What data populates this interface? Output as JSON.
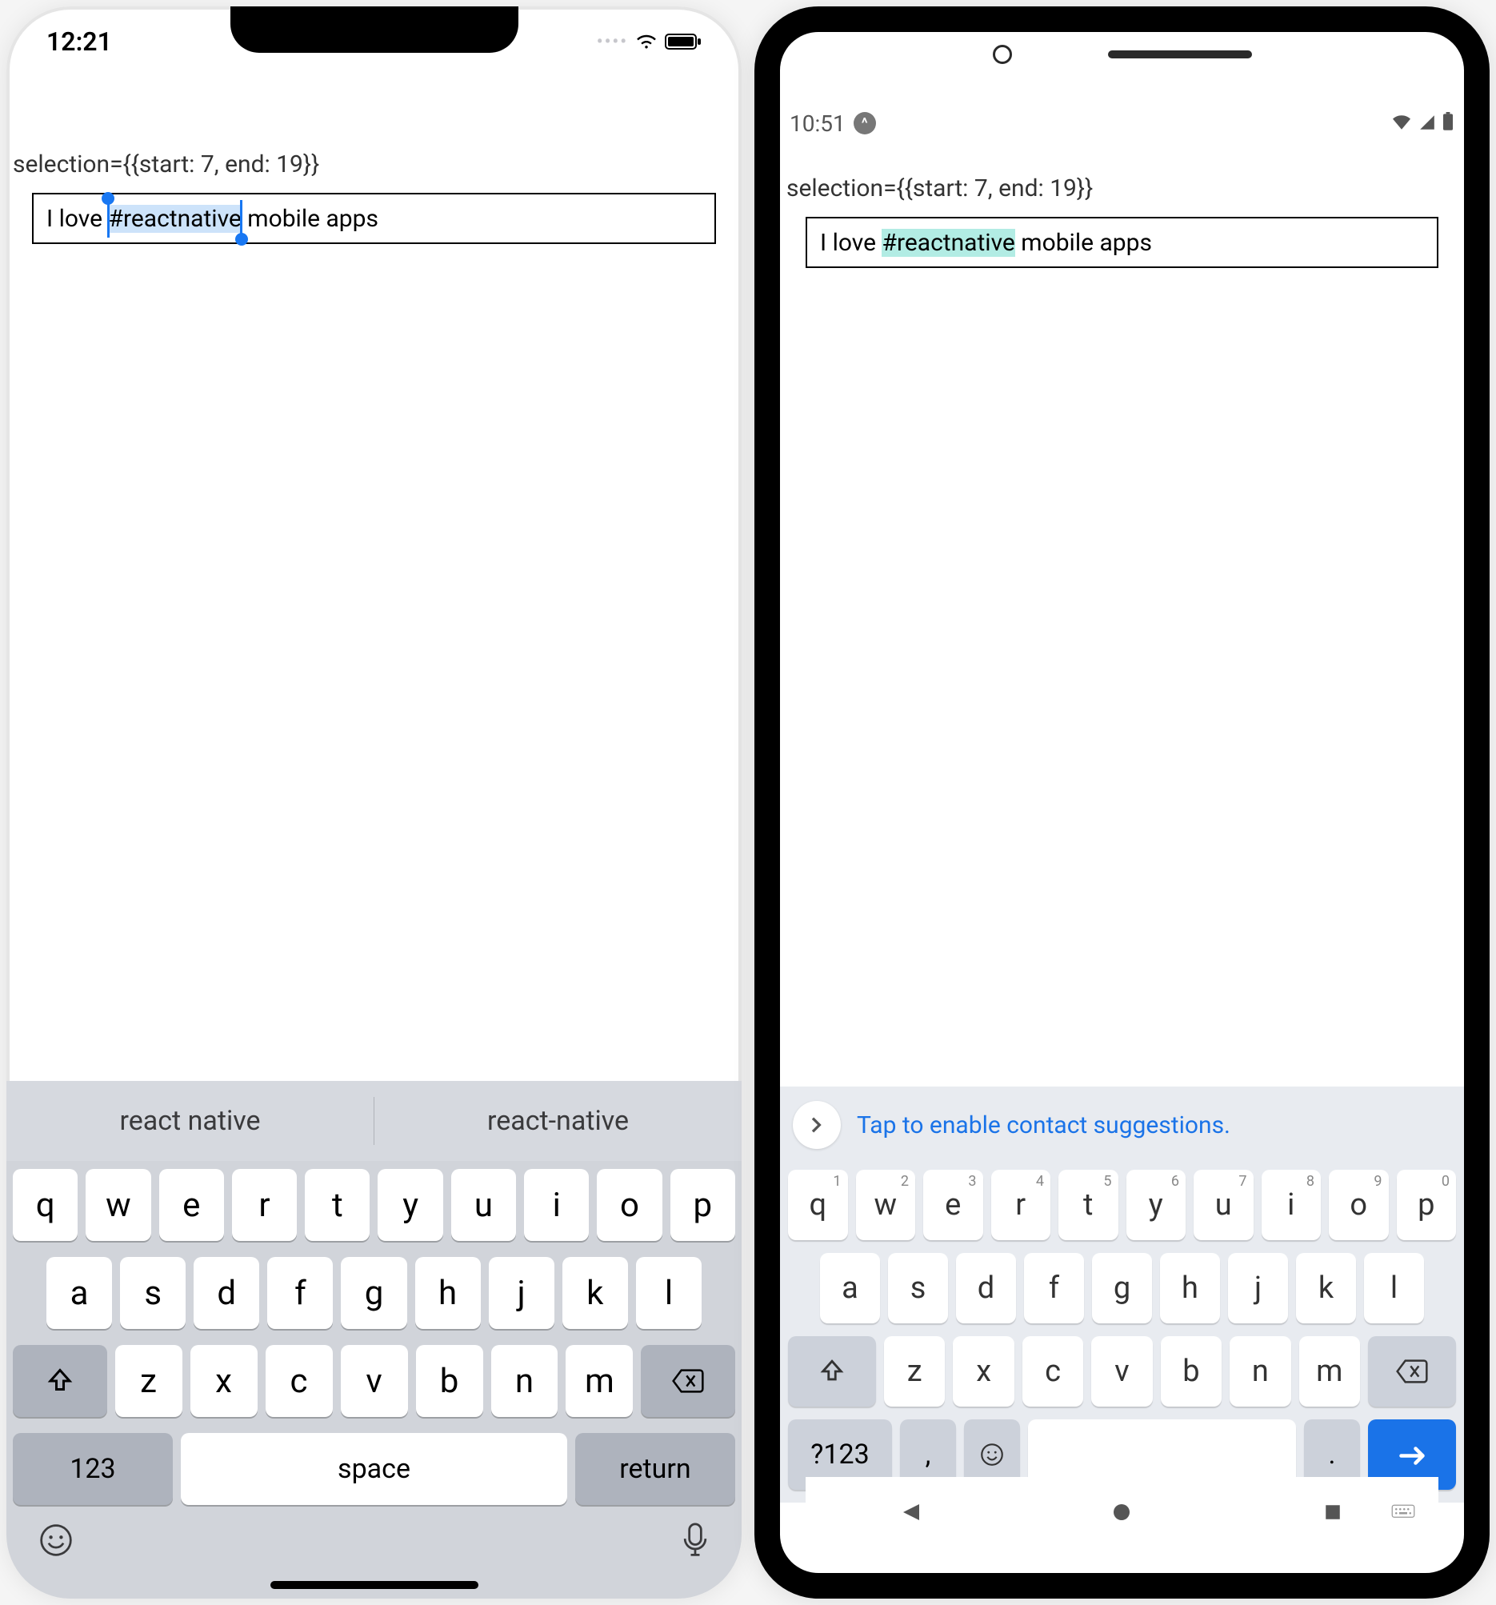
{
  "selection_label": "selection={{start: 7, end: 19}}",
  "input": {
    "before": "I love ",
    "selected": "#reactnative",
    "after": " mobile apps"
  },
  "ios": {
    "time": "12:21",
    "suggestions": [
      "react native",
      "react-native"
    ],
    "keys_row1": [
      "q",
      "w",
      "e",
      "r",
      "t",
      "y",
      "u",
      "i",
      "o",
      "p"
    ],
    "keys_row2": [
      "a",
      "s",
      "d",
      "f",
      "g",
      "h",
      "j",
      "k",
      "l"
    ],
    "keys_row3": [
      "z",
      "x",
      "c",
      "v",
      "b",
      "n",
      "m"
    ],
    "key_123": "123",
    "key_space": "space",
    "key_return": "return"
  },
  "android": {
    "time": "10:51",
    "suggestion_text": "Tap to enable contact suggestions.",
    "keys_row1": [
      "q",
      "w",
      "e",
      "r",
      "t",
      "y",
      "u",
      "i",
      "o",
      "p"
    ],
    "keys_row1_sup": [
      "1",
      "2",
      "3",
      "4",
      "5",
      "6",
      "7",
      "8",
      "9",
      "0"
    ],
    "keys_row2": [
      "a",
      "s",
      "d",
      "f",
      "g",
      "h",
      "j",
      "k",
      "l"
    ],
    "keys_row3": [
      "z",
      "x",
      "c",
      "v",
      "b",
      "n",
      "m"
    ],
    "key_123": "?123",
    "key_comma": ",",
    "key_dot": "."
  }
}
